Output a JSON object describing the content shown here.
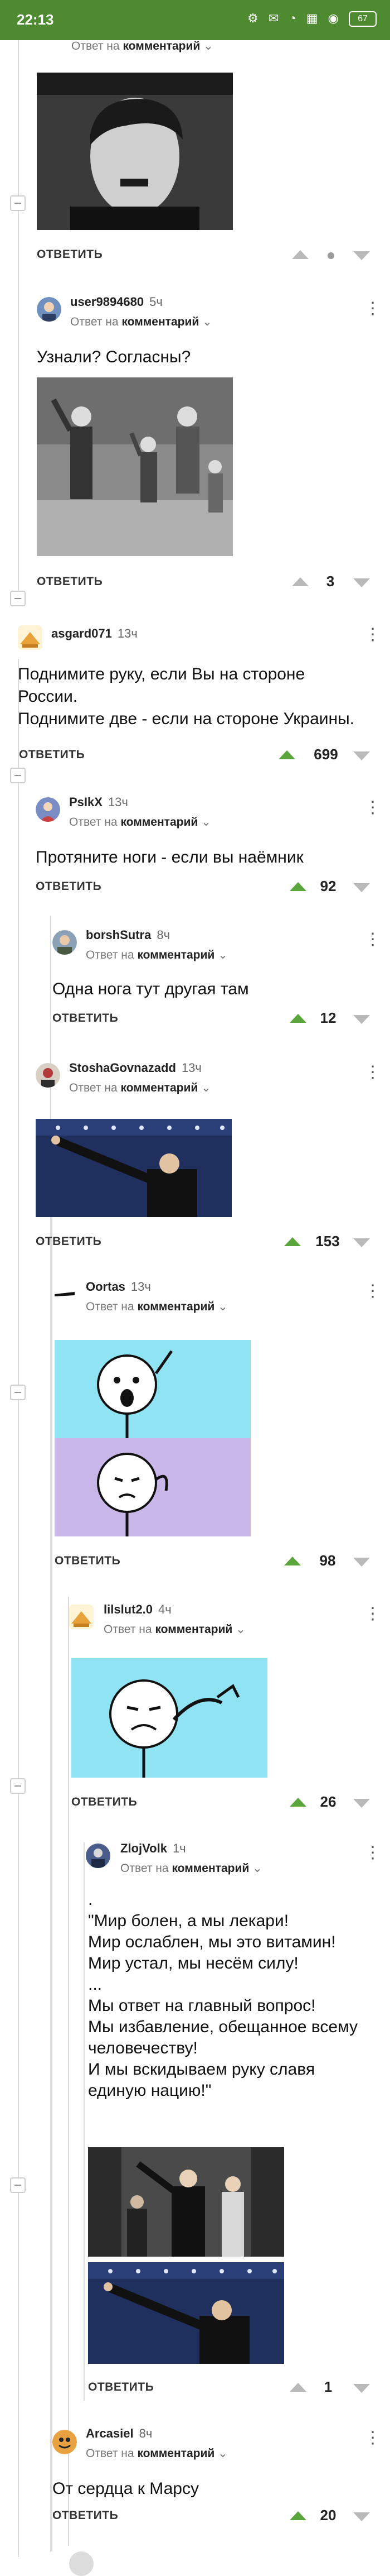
{
  "status_bar": {
    "time": "22:13",
    "icons": "⚙ ✉ ◔ ▦ ◉ ",
    "battery": "67"
  },
  "ui": {
    "reply_prefix": "Ответ на",
    "reply_target": "комментарий",
    "answer_label": "ОТВЕТИТЬ"
  },
  "comments": [
    {
      "id": "c0",
      "text": "",
      "score": ""
    },
    {
      "id": "c1",
      "user": "user9894680",
      "ago": "5ч",
      "text": "Узнали? Согласны?",
      "score": "3"
    },
    {
      "id": "c2",
      "user": "asgard071",
      "ago": "13ч",
      "text": "Поднимите руку, если Вы на стороне\nРоссии.\nПоднимите две - если на стороне Украины.",
      "score": "699"
    },
    {
      "id": "c3",
      "user": "PsIkX",
      "ago": "13ч",
      "text": "Протяните ноги - если вы наёмник",
      "score": "92"
    },
    {
      "id": "c4",
      "user": "borshSutra",
      "ago": "8ч",
      "text": "Одна нога тут другая там",
      "score": "12"
    },
    {
      "id": "c5",
      "user": "StoshaGovnazadd",
      "ago": "13ч",
      "text": "",
      "score": "153"
    },
    {
      "id": "c6",
      "user": "Oortas",
      "ago": "13ч",
      "text": "",
      "score": "98"
    },
    {
      "id": "c7",
      "user": "lilslut2.0",
      "ago": "4ч",
      "text": "",
      "score": "26"
    },
    {
      "id": "c8",
      "user": "ZlojVolk",
      "ago": "1ч",
      "text": ".\n\"Мир болен, а мы лекари!\nМир ослаблен, мы это витамин!\nМир устал, мы несём силу!\n...\nМы ответ на главный вопрос!\nМы избавление, обещанное всему\nчеловечеству!\nИ мы вскидываем руку славя\nединую нацию!\"",
      "score": "1"
    },
    {
      "id": "c9",
      "user": "Arcasiel",
      "ago": "8ч",
      "text": "От сердца к Марсу",
      "score": "20"
    }
  ],
  "colors": {
    "status_bar": "#4e8a2f",
    "upvote_active": "#5aa63c",
    "vote_neutral": "#b9b9b9"
  }
}
